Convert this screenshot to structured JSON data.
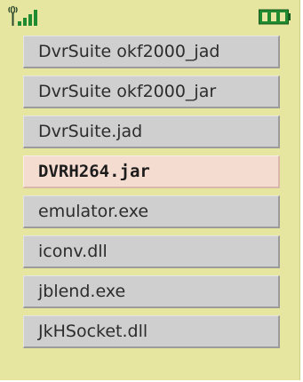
{
  "status_bar": {
    "signal_icon": "signal-strength-icon",
    "battery_icon": "battery-icon",
    "battery_color": "#1f8a2f"
  },
  "file_list": {
    "selected_index": 3,
    "items": [
      {
        "label": "DvrSuite okf2000_jad"
      },
      {
        "label": "DvrSuite okf2000_jar"
      },
      {
        "label": "DvrSuite.jad"
      },
      {
        "label": "DVRH264.jar"
      },
      {
        "label": "emulator.exe"
      },
      {
        "label": "iconv.dll"
      },
      {
        "label": "jblend.exe"
      },
      {
        "label": "JkHSocket.dll"
      }
    ]
  },
  "colors": {
    "screen_background": "#e7e6a1",
    "item_background": "#cfcfcf",
    "selected_background": "#f5dcd0"
  }
}
